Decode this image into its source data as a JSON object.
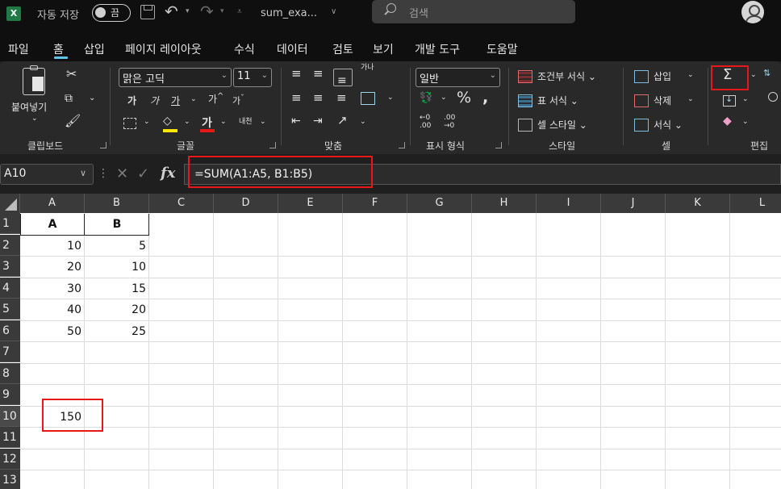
{
  "titlebar": {
    "logo": "X",
    "autosave_label": "자동 저장",
    "autosave_state": "끔",
    "file_name": "sum_exa...",
    "search_placeholder": "검색"
  },
  "menu": {
    "tabs": [
      "파일",
      "홈",
      "삽입",
      "페이지 레이아웃",
      "수식",
      "데이터",
      "검토",
      "보기",
      "개발 도구",
      "도움말"
    ],
    "active_tab": "홈"
  },
  "ribbon": {
    "clipboard": {
      "paste_label": "붙여넣기",
      "group_label": "클립보드"
    },
    "font": {
      "font_name": "맑은 고딕",
      "font_size": "11",
      "bold": "가",
      "italic": "가",
      "underline": "가",
      "increase_size": "가",
      "decrease_size": "가",
      "font_color": "가",
      "phonetic": "내천",
      "group_label": "글꼴"
    },
    "alignment": {
      "group_label": "맞춤",
      "wrap_label": "가나"
    },
    "number": {
      "format": "일반",
      "group_label": "표시 형식"
    },
    "styles": {
      "conditional_format": "조건부 서식",
      "format_table": "표 서식",
      "cell_styles": "셀 스타일",
      "group_label": "스타일"
    },
    "cells": {
      "insert": "삽입",
      "delete": "삭제",
      "format": "서식",
      "group_label": "셀"
    },
    "editing": {
      "group_label": "편집"
    }
  },
  "formula_bar": {
    "name_box": "A10",
    "formula": "=SUM(A1:A5, B1:B5)",
    "fx": "fx"
  },
  "grid": {
    "columns": [
      "A",
      "B",
      "C",
      "D",
      "E",
      "F",
      "G",
      "H",
      "I",
      "J",
      "K",
      "L"
    ],
    "rows": [
      "1",
      "2",
      "3",
      "4",
      "5",
      "6",
      "7",
      "8",
      "9",
      "10",
      "11",
      "12",
      "13"
    ],
    "header_a": "A",
    "header_b": "B",
    "col_a_values": [
      "10",
      "20",
      "30",
      "40",
      "50"
    ],
    "col_b_values": [
      "5",
      "10",
      "15",
      "20",
      "25"
    ],
    "result": "150"
  },
  "colors": {
    "highlight": "#e81818",
    "active_tab_underline": "#5fc4e8",
    "excel_green": "#1f7a45"
  }
}
